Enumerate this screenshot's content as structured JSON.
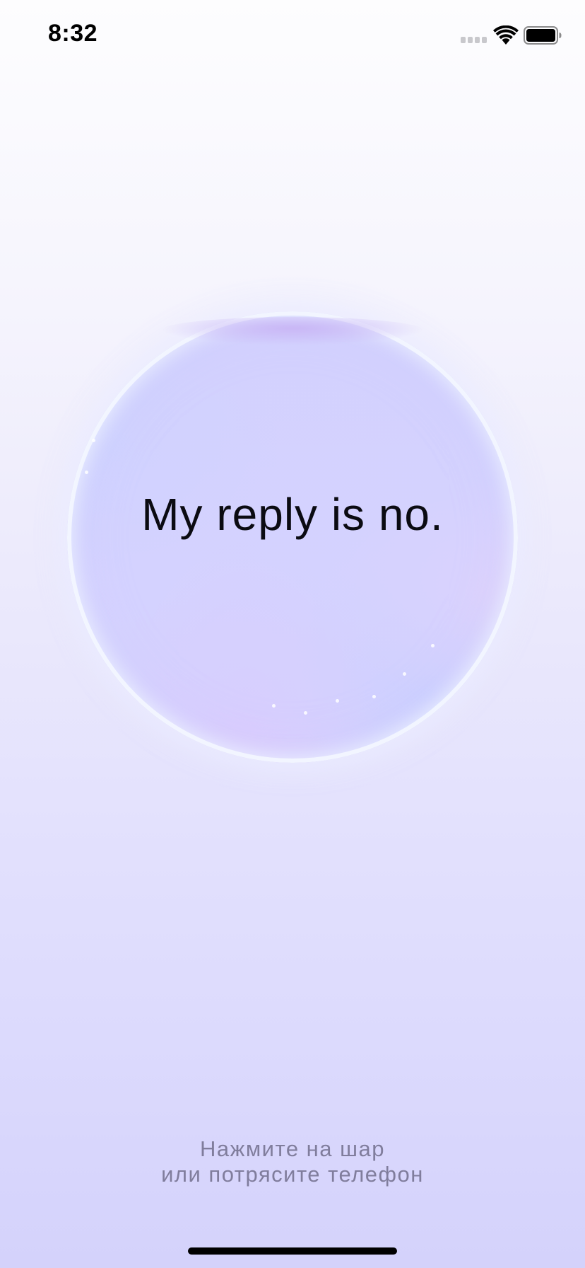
{
  "status_bar": {
    "time": "8:32",
    "icons": [
      "signal-icon",
      "wifi-icon",
      "battery-icon"
    ]
  },
  "ball": {
    "answer": "My reply is no."
  },
  "hint": {
    "line1": "Нажмите на шар",
    "line2": "или потрясите телефон"
  },
  "colors": {
    "background_top": "#fdfdfe",
    "background_bottom": "#d4d2fb",
    "ball": "#d4d2fe",
    "hint_text": "#807d9c",
    "answer_text": "#0b0b12"
  }
}
